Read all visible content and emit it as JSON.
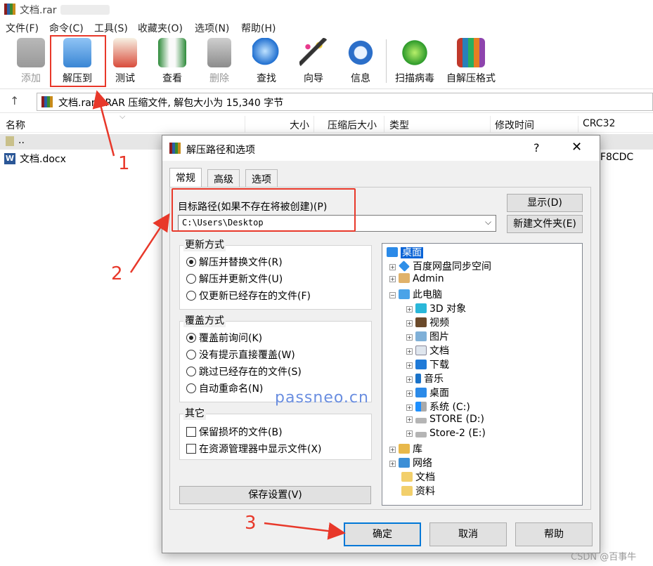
{
  "window": {
    "title": "文档.rar"
  },
  "menu": [
    "文件(F)",
    "命令(C)",
    "工具(S)",
    "收藏夹(O)",
    "选项(N)",
    "帮助(H)"
  ],
  "toolbar": [
    {
      "label": "添加",
      "icon": "archive-add-icon",
      "disabled": true
    },
    {
      "label": "解压到",
      "icon": "extract-folder-icon",
      "disabled": false
    },
    {
      "label": "测试",
      "icon": "test-clipboard-icon",
      "disabled": false
    },
    {
      "label": "查看",
      "icon": "view-book-icon",
      "disabled": false
    },
    {
      "label": "删除",
      "icon": "trash-icon",
      "disabled": true
    },
    {
      "label": "查找",
      "icon": "magnifier-icon",
      "disabled": false
    },
    {
      "label": "向导",
      "icon": "wizard-wand-icon",
      "disabled": false
    },
    {
      "label": "信息",
      "icon": "info-icon",
      "disabled": false
    },
    {
      "label": "扫描病毒",
      "icon": "virus-scan-icon",
      "disabled": false
    },
    {
      "label": "自解压格式",
      "icon": "sfx-box-icon",
      "disabled": false
    }
  ],
  "address": {
    "text": "文档.rar - RAR 压缩文件, 解包大小为 15,340 字节"
  },
  "columns": [
    "名称",
    "大小",
    "压缩后大小",
    "类型",
    "修改时间",
    "CRC32"
  ],
  "files": [
    {
      "name": "..",
      "crc": ""
    },
    {
      "name": "文档.docx",
      "crc": "0F8CDC"
    }
  ],
  "dialog": {
    "title": "解压路径和选项",
    "help": "?",
    "close": "✕",
    "tabs": [
      "常规",
      "高级",
      "选项"
    ],
    "path_label": "目标路径(如果不存在将被创建)(P)",
    "path_value": "C:\\Users\\Desktop",
    "show_btn": "显示(D)",
    "newfolder_btn": "新建文件夹(E)",
    "update_title": "更新方式",
    "update_opts": [
      "解压并替换文件(R)",
      "解压并更新文件(U)",
      "仅更新已经存在的文件(F)"
    ],
    "overwrite_title": "覆盖方式",
    "overwrite_opts": [
      "覆盖前询问(K)",
      "没有提示直接覆盖(W)",
      "跳过已经存在的文件(S)",
      "自动重命名(N)"
    ],
    "other_title": "其它",
    "other_opts": [
      "保留损坏的文件(B)",
      "在资源管理器中显示文件(X)"
    ],
    "save_btn": "保存设置(V)",
    "tree": [
      {
        "label": "桌面",
        "icon": "desktop-icon",
        "selected": true
      },
      {
        "label": "百度网盘同步空间",
        "icon": "cloud-drive-icon"
      },
      {
        "label": "Admin",
        "icon": "user-folder-icon"
      },
      {
        "label": "此电脑",
        "icon": "computer-icon"
      },
      {
        "label": "3D 对象",
        "icon": "3d-objects-icon"
      },
      {
        "label": "视频",
        "icon": "video-icon"
      },
      {
        "label": "图片",
        "icon": "pictures-icon"
      },
      {
        "label": "文档",
        "icon": "documents-icon"
      },
      {
        "label": "下载",
        "icon": "download-icon"
      },
      {
        "label": "音乐",
        "icon": "music-icon"
      },
      {
        "label": "桌面",
        "icon": "desktop-icon"
      },
      {
        "label": "系统 (C:)",
        "icon": "drive-c-icon"
      },
      {
        "label": "STORE (D:)",
        "icon": "drive-icon"
      },
      {
        "label": "Store-2 (E:)",
        "icon": "drive-icon"
      },
      {
        "label": "库",
        "icon": "library-icon"
      },
      {
        "label": "网络",
        "icon": "network-icon"
      },
      {
        "label": "文档",
        "icon": "folder-icon"
      },
      {
        "label": "资料",
        "icon": "folder-icon"
      }
    ],
    "ok": "确定",
    "cancel": "取消",
    "helpbtn": "帮助"
  },
  "annotations": [
    "1",
    "2",
    "3"
  ],
  "watermark": "passneo.cn",
  "credit": "CSDN @百事牛",
  "colors": {
    "accent": "#e8382a",
    "primary_border": "#0078d7",
    "watermark": "#6a8ee0"
  }
}
